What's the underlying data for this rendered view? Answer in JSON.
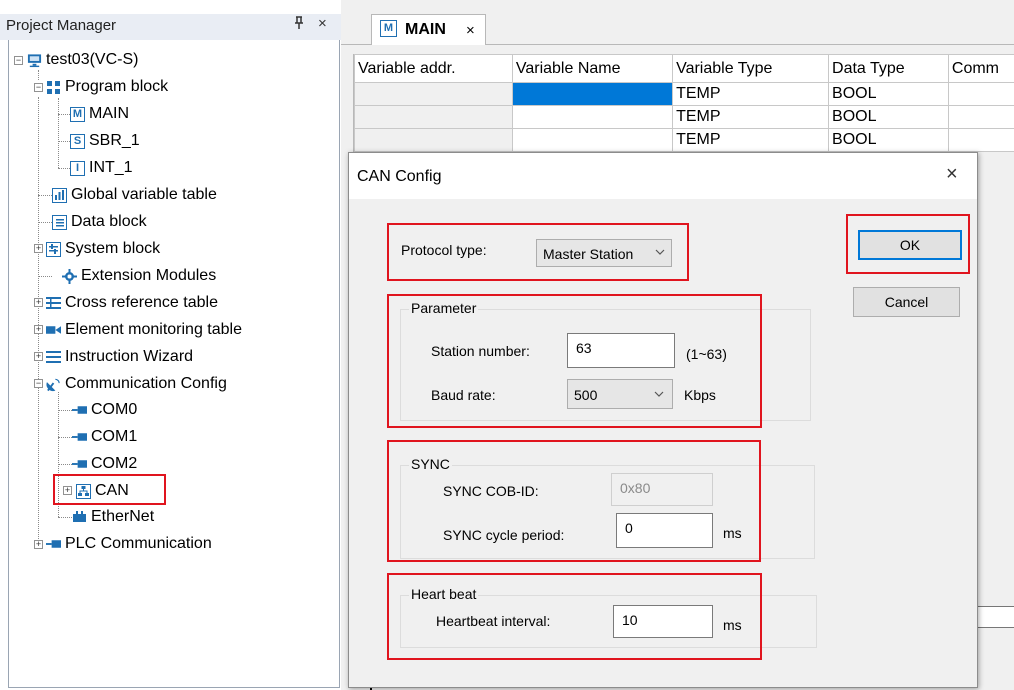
{
  "project_manager": {
    "title": "Project Manager",
    "pin_icon": "pin-icon",
    "close_glyph": "×",
    "tree": {
      "root": "test03(VC-S)",
      "program_block": "Program block",
      "main": "MAIN",
      "sbr": "SBR_1",
      "int": "INT_1",
      "global_var": "Global variable table",
      "data_block": "Data block",
      "system_block": "System block",
      "ext_modules": "Extension Modules",
      "cross_ref": "Cross reference table",
      "elem_mon": "Element monitoring table",
      "instr_wizard": "Instruction Wizard",
      "comm_config": "Communication Config",
      "com0": "COM0",
      "com1": "COM1",
      "com2": "COM2",
      "can": "CAN",
      "ethernet": "EtherNet",
      "plc_comm": "PLC Communication"
    }
  },
  "editor": {
    "tab_label": "MAIN",
    "tab_icon_letter": "M",
    "tab_close": "×",
    "columns": [
      "Variable addr.",
      "Variable Name",
      "Variable Type",
      "Data Type",
      "Comm"
    ],
    "rows": [
      [
        "",
        "",
        "TEMP",
        "BOOL",
        ""
      ],
      [
        "",
        "",
        "TEMP",
        "BOOL",
        ""
      ],
      [
        "",
        "",
        "TEMP",
        "BOOL",
        ""
      ]
    ]
  },
  "dialog": {
    "title": "CAN Config",
    "close_glyph": "×",
    "protocol_label": "Protocol type:",
    "protocol_value": "Master Station",
    "ok_label": "OK",
    "cancel_label": "Cancel",
    "parameter": {
      "group_label": "Parameter",
      "station_label": "Station number:",
      "station_value": "63",
      "station_range": "(1~63)",
      "baud_label": "Baud rate:",
      "baud_value": "500",
      "baud_unit": "Kbps"
    },
    "sync": {
      "group_label": "SYNC",
      "cobid_label": "SYNC  COB-ID:",
      "cobid_value": "0x80",
      "period_label": "SYNC cycle period:",
      "period_value": "0",
      "period_unit": "ms"
    },
    "heartbeat": {
      "group_label": "Heart beat",
      "interval_label": "Heartbeat interval:",
      "interval_value": "10",
      "interval_unit": "ms"
    }
  },
  "colors": {
    "highlight_red": "#e0141e",
    "selection_blue": "#0078d7",
    "ok_border_blue": "#0078d7"
  }
}
